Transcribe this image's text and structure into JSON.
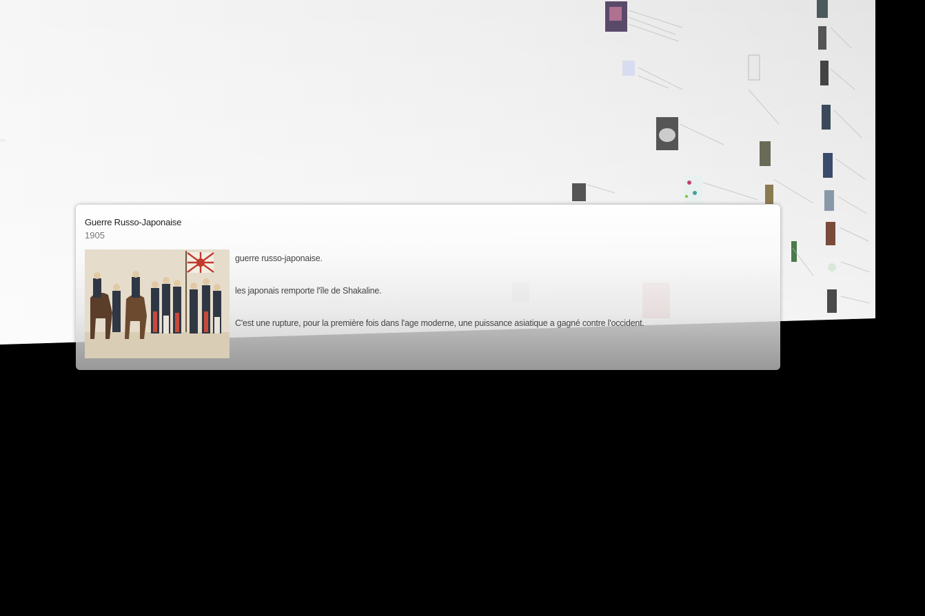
{
  "event": {
    "title": "Guerre Russo-Japonaise",
    "date": "1905",
    "paragraphs": [
      "guerre russo-japonaise.",
      "les japonais remporte l'île de Shakaline.",
      "C'est une rupture, pour la première fois dans l'age moderne, une puissance asiatique a gagné contre l'occident."
    ],
    "image_icon": "soldiers-illustration-icon"
  },
  "background": {
    "blurred_text": "...",
    "colors": {
      "plane": "#f0f0f0",
      "outside": "#000000",
      "flag_red": "#c23a2e"
    }
  }
}
